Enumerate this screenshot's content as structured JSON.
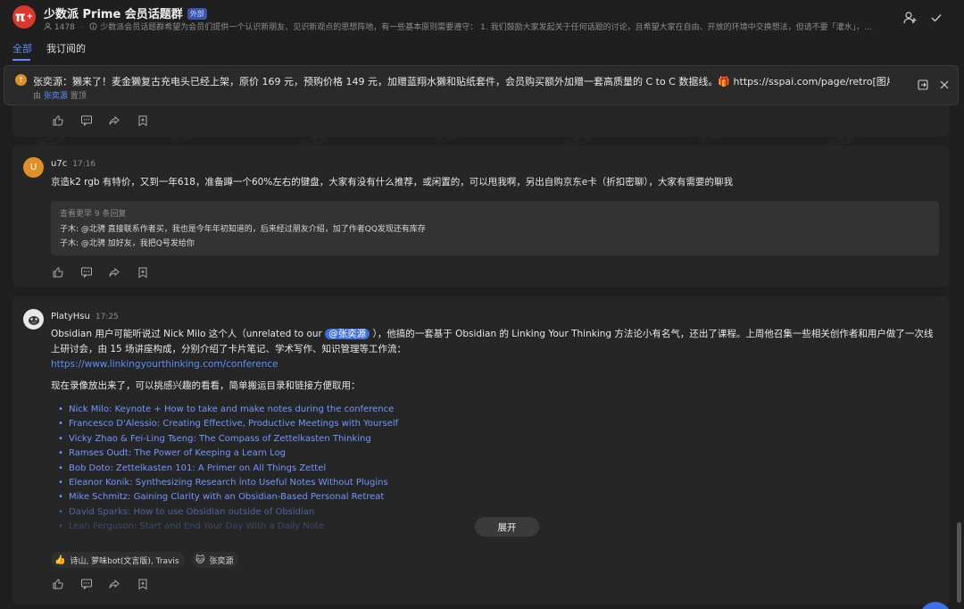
{
  "header": {
    "logo_text": "π",
    "logo_sup": "+",
    "title": "少数派 Prime 会员话题群",
    "badge": "外部",
    "member_count": "1478",
    "description": "少数派会员话题群希望为会员们提供一个认识新朋友、见识新观点的思想阵地，有一些基本原则需要遵守： 1. 我们鼓励大家发起关于任何话题的讨论，且希望大家在自由、开放的环境中交换想法，但请不要「灌水」，也..."
  },
  "tabs": [
    {
      "label": "全部"
    },
    {
      "label": "我订阅的"
    }
  ],
  "pinned": {
    "text": "张奕源：獭来了！麦金獭复古充电头已经上架，原价 169 元，预购价格 149 元，加赠蓝翔水獭和贴纸套件，会员购买额外加赠一套高质量的 C to C 数据线。🎁 https://sspai.com/page/retro[图片][图片]",
    "by_prefix": "由",
    "by_name": "张奕源",
    "by_suffix": "置顶"
  },
  "posts": [
    {
      "author": "u7c",
      "avatar_letter": "U",
      "avatar_color": "#e0902a",
      "time": "17:16",
      "text": "京造k2 rgb 有特价，又到一年618，准备蹲一个60%左右的键盘，大家有没有什么推荐，或闲置的，可以甩我啊，另出自购京东e卡（折扣密聊），大家有需要的聊我",
      "replies_header": "查看更早 9 条回复",
      "replies": [
        "子木: @北骋 直接联系作者买，我也是今年年初知道的，后来经过朋友介绍，加了作者QQ发现还有库存",
        "子木: @北骋 加好友，我把Q号发给你"
      ]
    },
    {
      "author": "PlatyHsu",
      "time": "17:25",
      "text_before": "Obsidian 用户可能听说过 Nick Milo 这个人（unrelated to our",
      "mention": "@张奕源",
      "text_after": "），他搞的一套基于 Obsidian 的 Linking Your Thinking 方法论小有名气，还出了课程。上周他召集一些相关创作者和用户做了一次线上研讨会，由 15 场讲座构成，分别介绍了卡片笔记、学术写作、知识管理等工作流：",
      "link": "https://www.linkingyourthinking.com/conference",
      "intro": "现在录像放出来了，可以挑感兴趣的看看，简单搬运目录和链接方便取用：",
      "talks": [
        "Nick Milo: Keynote + How to take and make notes during the conference",
        "Francesco D'Alessio: Creating Effective, Productive Meetings with Yourself",
        "Vicky Zhao & Fei-Ling Tseng: The Compass of Zettelkasten Thinking",
        "Ramses Oudt: The Power of Keeping a Learn Log",
        "Bob Doto: Zettelkasten 101: A Primer on All Things Zettel",
        "Eleanor Konik: Synthesizing Research into Useful Notes Without Plugins",
        "Mike Schmitz: Gaining Clarity with an Obsidian-Based Personal Retreat",
        "David Sparks: How to use Obsidian outside of Obsidian",
        "Leah Ferguson: Start and End Your Day With a Daily Note"
      ],
      "expand_label": "展开",
      "reactions": [
        {
          "emoji": "👍",
          "users": "诗山, 萝味bot(文言版), Travis"
        },
        {
          "emoji": "🐱",
          "users": "张奕源"
        }
      ]
    }
  ],
  "watermark": "张奕源 7425",
  "colors": {
    "accent": "#5b8dff",
    "background": "#1f1f1f",
    "card": "#262626",
    "logo": "#d9382c"
  }
}
